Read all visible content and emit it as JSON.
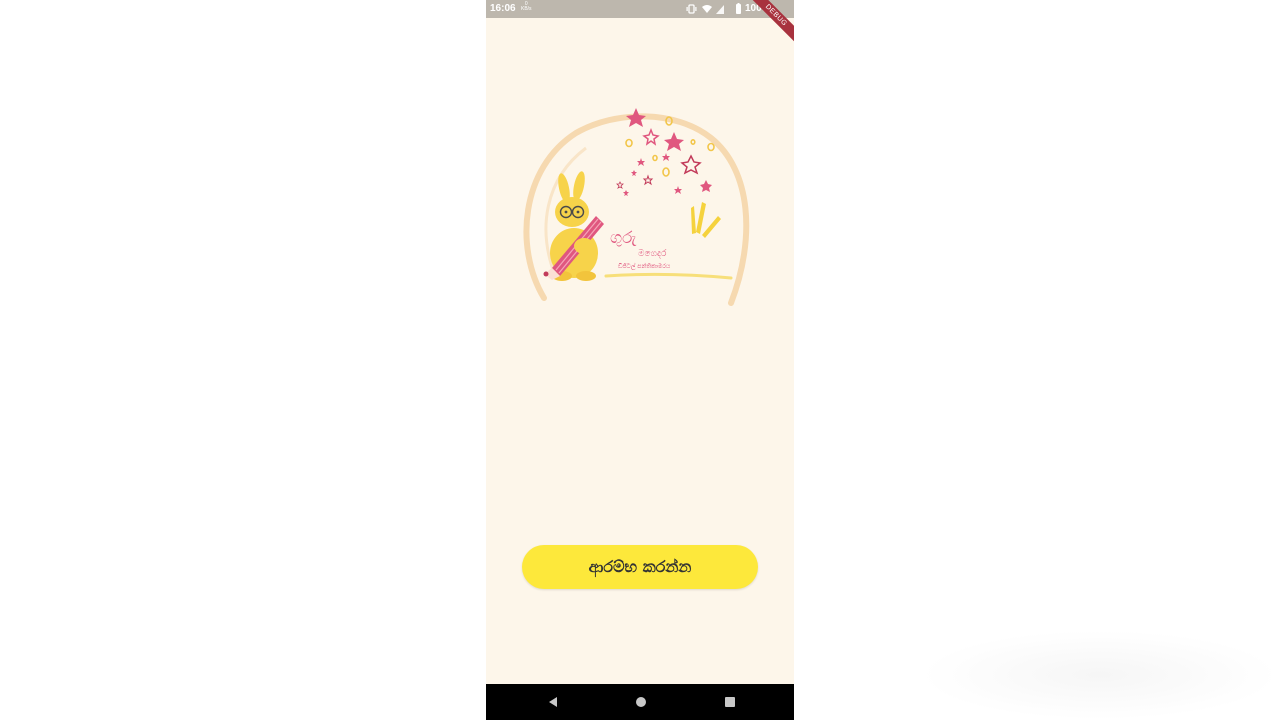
{
  "status_bar": {
    "time": "16:06",
    "net_speed_value": "0",
    "net_speed_unit": "KB/s",
    "battery": "100%"
  },
  "debug_banner": "DEBUG",
  "logo": {
    "title_line1": "ගුරු",
    "title_line2": "මගෙදර",
    "subtitle": "ඩිජිටල් පන්තිකාමරය"
  },
  "start_button": {
    "label": "ආරම්භ කරන්න"
  },
  "nav_bar": {
    "back": "back-icon",
    "home": "home-icon",
    "recents": "recents-icon"
  },
  "colors": {
    "background": "#fdf6ea",
    "button": "#fde83b",
    "status_bar": "#bdb7ad",
    "accent_pink": "#e0577f",
    "bunny_yellow": "#f7d34a"
  }
}
